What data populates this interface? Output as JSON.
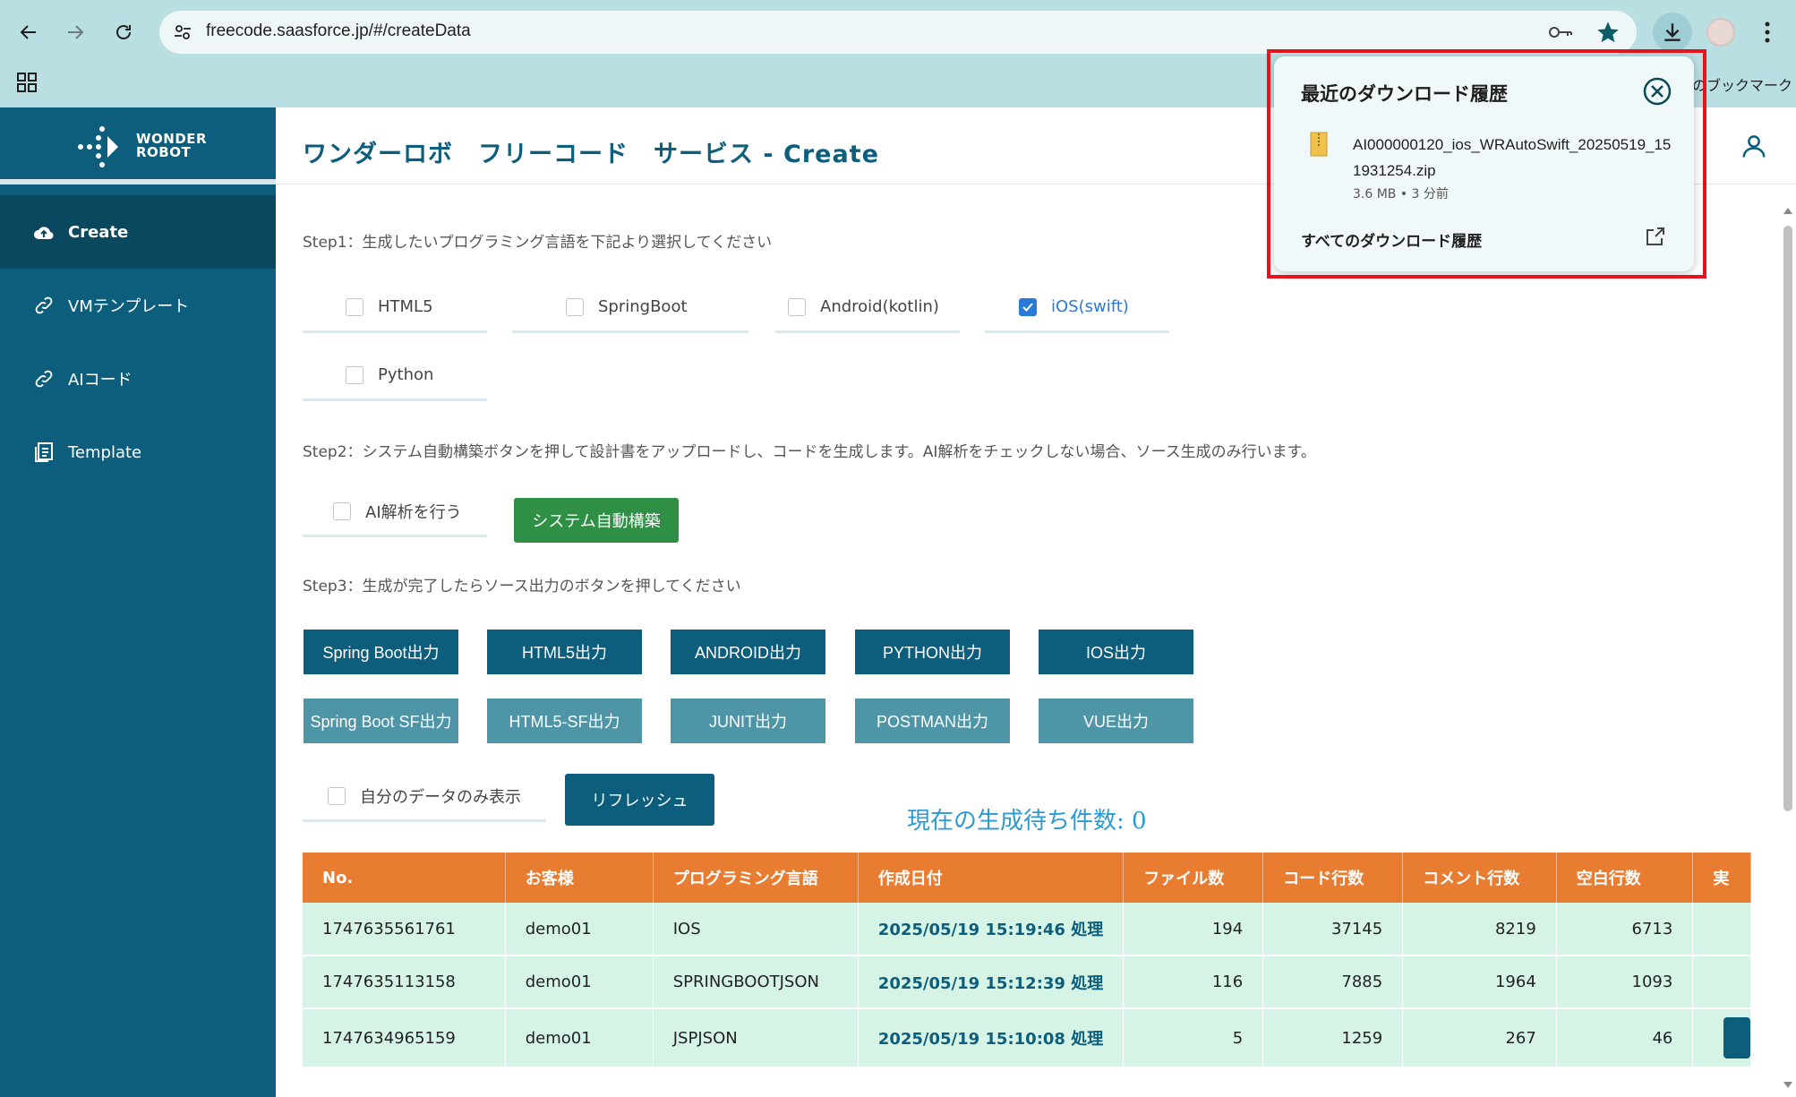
{
  "browser": {
    "url": "freecode.saasforce.jp/#/createData",
    "bookmark_label": "のブックマーク"
  },
  "app": {
    "logo_line1": "WONDER",
    "logo_line2": "ROBOT",
    "title": "ワンダーロボ　フリーコード　サービス - Create",
    "sidebar": [
      {
        "label": "Create",
        "icon": "cloud-upload-icon"
      },
      {
        "label": "VMテンプレート",
        "icon": "link-icon"
      },
      {
        "label": "AIコード",
        "icon": "link-icon"
      },
      {
        "label": "Template",
        "icon": "document-icon"
      }
    ]
  },
  "steps": {
    "step1": "Step1：生成したいプログラミング言語を下記より選択してください",
    "step2": "Step2：システム自動構築ボタンを押して設計書をアップロードし、コードを生成します。AI解析をチェックしない場合、ソース生成のみ行います。",
    "step3": "Step3：生成が完了したらソース出力のボタンを押してください"
  },
  "languages": [
    {
      "label": "HTML5",
      "checked": false
    },
    {
      "label": "SpringBoot",
      "checked": false
    },
    {
      "label": "Android(kotlin)",
      "checked": false
    },
    {
      "label": "iOS(swift)",
      "checked": true
    },
    {
      "label": "Python",
      "checked": false
    }
  ],
  "ai_check_label": "AI解析を行う",
  "auto_build_button": "システム自動構築",
  "output_buttons_row1": [
    "Spring Boot出力",
    "HTML5出力",
    "ANDROID出力",
    "PYTHON出力",
    "IOS出力"
  ],
  "output_buttons_row2": [
    "Spring Boot SF出力",
    "HTML5-SF出力",
    "JUNIT出力",
    "POSTMAN出力",
    "VUE出力"
  ],
  "own_data_label": "自分のデータのみ表示",
  "refresh_button": "リフレッシュ",
  "pending_text": "現在の生成待ち件数: 0",
  "table": {
    "headers": [
      "No.",
      "お客様",
      "プログラミング言語",
      "作成日付",
      "ファイル数",
      "コード行数",
      "コメント行数",
      "空白行数",
      "実"
    ],
    "rows": [
      [
        "1747635561761",
        "demo01",
        "IOS",
        "2025/05/19 15:19:46 処理",
        "194",
        "37145",
        "8219",
        "6713"
      ],
      [
        "1747635113158",
        "demo01",
        "SPRINGBOOTJSON",
        "2025/05/19 15:12:39 処理",
        "116",
        "7885",
        "1964",
        "1093"
      ],
      [
        "1747634965159",
        "demo01",
        "JSPJSON",
        "2025/05/19 15:10:08 処理",
        "5",
        "1259",
        "267",
        "46"
      ]
    ]
  },
  "download_popup": {
    "title": "最近のダウンロード履歴",
    "filename": "AI000000120_ios_WRAutoSwift_20250519_151931254.zip",
    "meta": "3.6 MB • 3 分前",
    "all_label": "すべてのダウンロード履歴"
  },
  "colors": {
    "sidebar": "#0c5e7c",
    "table_header": "#e87d31",
    "row_bg": "#d6f4e6",
    "accent_blue": "#2a7ad8",
    "highlight_frame": "#e3141b"
  }
}
